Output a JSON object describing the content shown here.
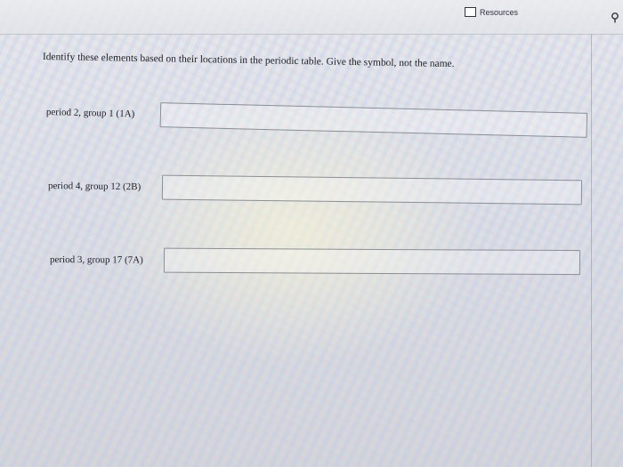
{
  "header": {
    "resources_label": "Resources",
    "resources_icon": "page-icon",
    "pin_icon": "pin-icon"
  },
  "question": {
    "prompt": "Identify these elements based on their locations in the periodic table. Give the symbol, not the name."
  },
  "items": [
    {
      "label": "period 2, group 1 (1A)",
      "value": ""
    },
    {
      "label": "period 4, group 12 (2B)",
      "value": ""
    },
    {
      "label": "period 3, group 17 (7A)",
      "value": ""
    }
  ]
}
